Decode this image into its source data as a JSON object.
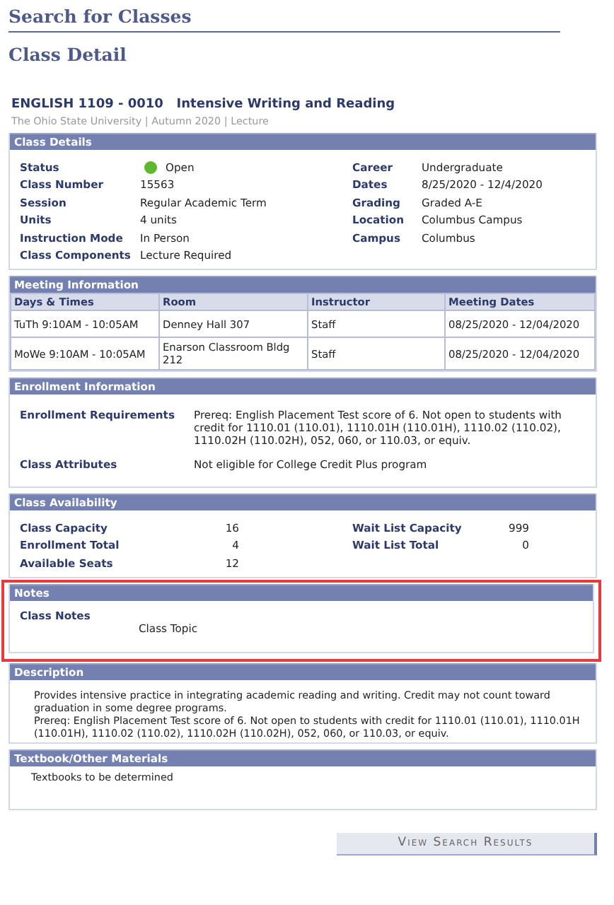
{
  "page_title": "Search for Classes",
  "subtitle": "Class Detail",
  "course": {
    "title": "ENGLISH 1109 - 0010   Intensive Writing and Reading",
    "meta": "The Ohio State University | Autumn 2020 | Lecture"
  },
  "class_details": {
    "header": "Class Details",
    "left": [
      {
        "label": "Status",
        "value": "Open",
        "kind": "status",
        "open": true
      },
      {
        "label": "Class Number",
        "value": "15563",
        "kind": "text"
      },
      {
        "label": "Session",
        "value": "Regular Academic Term",
        "kind": "text"
      },
      {
        "label": "Units",
        "value": "4 units",
        "kind": "text"
      },
      {
        "label": "Instruction Mode",
        "value": "In Person",
        "kind": "text"
      },
      {
        "label": "Class Components",
        "value": "Lecture Required",
        "kind": "text"
      }
    ],
    "right": [
      {
        "label": "Career",
        "value": "Undergraduate"
      },
      {
        "label": "Dates",
        "value": "8/25/2020 - 12/4/2020"
      },
      {
        "label": "Grading",
        "value": "Graded A-E"
      },
      {
        "label": "Location",
        "value": "Columbus Campus"
      },
      {
        "label": "Campus",
        "value": "Columbus"
      }
    ]
  },
  "meeting_information": {
    "header": "Meeting Information",
    "columns": [
      "Days & Times",
      "Room",
      "Instructor",
      "Meeting Dates"
    ],
    "rows": [
      [
        "TuTh 9:10AM - 10:05AM",
        "Denney Hall 307",
        "Staff",
        "08/25/2020 - 12/04/2020"
      ],
      [
        "MoWe 9:10AM - 10:05AM",
        "Enarson Classroom Bldg 212",
        "Staff",
        "08/25/2020 - 12/04/2020"
      ]
    ]
  },
  "enrollment_information": {
    "header": "Enrollment Information",
    "items": [
      {
        "label": "Enrollment Requirements",
        "value": "Prereq: English Placement Test score of 6. Not open to students with credit for 1110.01 (110.01), 1110.01H (110.01H), 1110.02 (110.02), 1110.02H (110.02H), 052, 060, or 110.03, or equiv."
      },
      {
        "label": "Class Attributes",
        "value": "Not eligible for College Credit Plus program"
      }
    ]
  },
  "class_availability": {
    "header": "Class Availability",
    "left": [
      {
        "label": "Class Capacity",
        "value": "16"
      },
      {
        "label": "Enrollment Total",
        "value": "4"
      },
      {
        "label": "Available Seats",
        "value": "12"
      }
    ],
    "right": [
      {
        "label": "Wait List Capacity",
        "value": "999"
      },
      {
        "label": "Wait List Total",
        "value": "0"
      }
    ]
  },
  "notes": {
    "header": "Notes",
    "highlighted": true,
    "label": "Class Notes",
    "value": "Class Topic"
  },
  "description": {
    "header": "Description",
    "paragraphs": [
      "Provides intensive practice in integrating academic reading and writing. Credit may not count toward graduation in some degree programs.",
      "Prereq: English Placement Test score of 6. Not open to students with credit for 1110.01 (110.01), 1110.01H (110.01H), 1110.02 (110.02), 1110.02H (110.02H), 052, 060, or 110.03, or equiv."
    ]
  },
  "textbook": {
    "header": "Textbook/Other Materials",
    "text": "Textbooks to be determined"
  },
  "button": "View Search Results"
}
